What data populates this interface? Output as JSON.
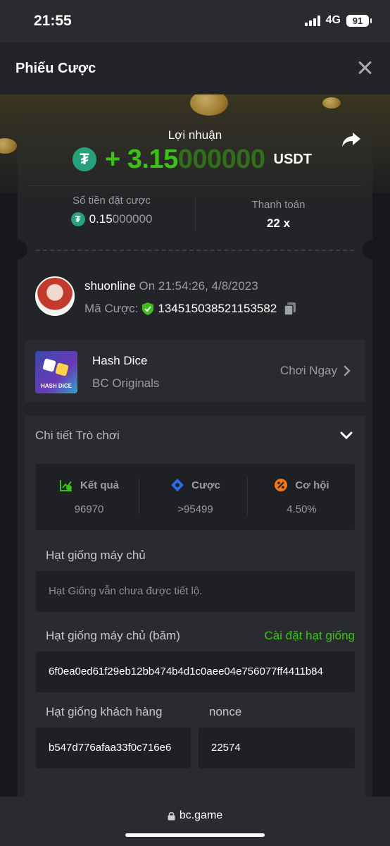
{
  "status": {
    "time": "21:55",
    "network": "4G",
    "battery": "91"
  },
  "header": {
    "title": "Phiếu Cược"
  },
  "profit": {
    "label": "Lợi nhuận",
    "sign": "+ ",
    "amount_main": "3.15",
    "amount_dim": "000000",
    "currency": "USDT",
    "currency_icon": "tether-icon"
  },
  "stats": {
    "bet_amount_label": "Số tiền đặt cược",
    "bet_amount_main": "0.15",
    "bet_amount_dim": "000000",
    "payout_label": "Thanh toán",
    "payout_value": "22 x"
  },
  "user": {
    "username": "shuonline",
    "time_prefix": " On ",
    "datetime": "21:54:26, 4/8/2023",
    "bet_id_label": "Mã Cược:",
    "bet_id": "134515038521153582"
  },
  "game": {
    "name": "Hash Dice",
    "provider": "BC Originals",
    "thumb_text": "HASH DICE",
    "play_label": "Chơi Ngay"
  },
  "details": {
    "title": "Chi tiết Trò chơi",
    "result": {
      "label": "Kết quả",
      "value": "96970"
    },
    "bet": {
      "label": "Cược",
      "value": ">95499"
    },
    "chance": {
      "label": "Cơ hội",
      "value": "4.50%"
    },
    "server_seed_label": "Hạt giống máy chủ",
    "server_seed_placeholder": "Hạt Giống vẫn chưa được tiết lộ.",
    "server_seed_hash_label": "Hạt giống máy chủ (băm)",
    "set_seed_link": "Cài đặt hạt giống",
    "server_seed_hash": "6f0ea0ed61f29eb12bb474b4d1c0aee04e756077ff4411b84",
    "client_seed_label": "Hạt giống khách hàng",
    "client_seed": "b547d776afaa33f0c716e6",
    "nonce_label": "nonce",
    "nonce": "22574"
  },
  "browser": {
    "url": "bc.game"
  },
  "colors": {
    "accent_green": "#3bc117",
    "tether": "#26a17b",
    "background": "#17181b"
  }
}
